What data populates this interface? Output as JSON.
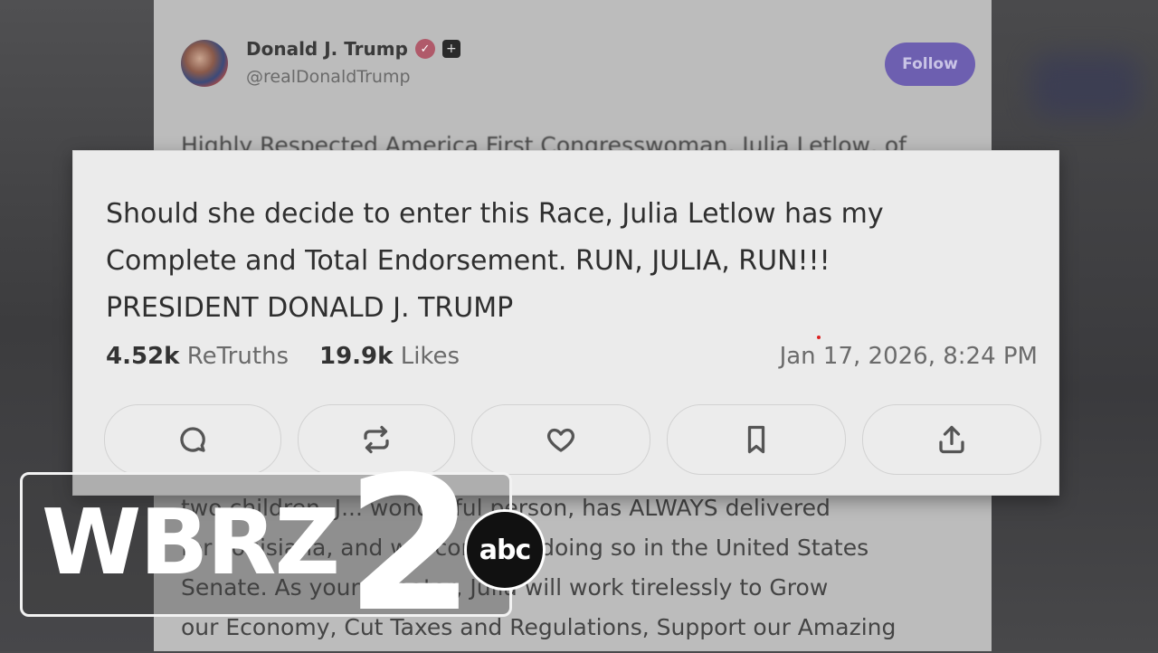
{
  "post": {
    "author_name": "Donald J. Trump",
    "author_handle": "@realDonaldTrump",
    "follow_label": "Follow",
    "top_snippet": "Highly Respected America First Congresswoman, Julia Letlow, of",
    "lower_lines": [
      "two children. J... wonderful person, has ALWAYS delivered",
      "for Louisiana, and will continue doing so in the United States",
      "Senate. As your Senator, Julia will work tirelessly to Grow",
      "our Economy, Cut Taxes and Regulations, Support our Amazing"
    ]
  },
  "callout": {
    "lines": [
      "Should she decide to enter this Race, Julia Letlow has my",
      "Complete and Total Endorsement. RUN, JULIA, RUN!!!",
      "PRESIDENT DONALD J. TRUMP"
    ],
    "retruths_count": "4.52k",
    "retruths_label": "ReTruths",
    "likes_count": "19.9k",
    "likes_label": "Likes",
    "timestamp": "Jan 17, 2026, 8:24 PM",
    "actions": [
      "reply",
      "retruth",
      "like",
      "bookmark",
      "share"
    ]
  },
  "logo": {
    "station": "WBRZ",
    "channel": "2",
    "network": "abc"
  },
  "colors": {
    "follow_button": "#6d5fb0",
    "callout_bg": "#ebebeb",
    "logo_white": "#ffffff"
  }
}
